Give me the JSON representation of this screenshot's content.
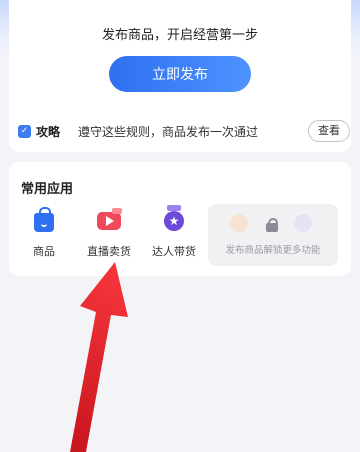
{
  "publish_card": {
    "description": "发布商品，开启经营第一步",
    "publish_button": "立即发布",
    "tips_label": "攻略",
    "tips_text": "遵守这些规则，商品发布一次通过",
    "view_button": "查看"
  },
  "common_apps": {
    "title": "常用应用",
    "items": [
      {
        "label": "商品",
        "icon": "shopping-bag-icon",
        "color": "#2f6ff0"
      },
      {
        "label": "直播卖货",
        "icon": "live-video-icon",
        "color": "#f0495a"
      },
      {
        "label": "达人带货",
        "icon": "talent-medal-icon",
        "color": "#6b4bd8"
      }
    ],
    "locked_hint": "发布商品解锁更多功能"
  },
  "annotation": {
    "arrow_color": "#e8242c"
  },
  "colors": {
    "accent": "#2f6ff0",
    "page_bg": "#f3f4f7"
  }
}
